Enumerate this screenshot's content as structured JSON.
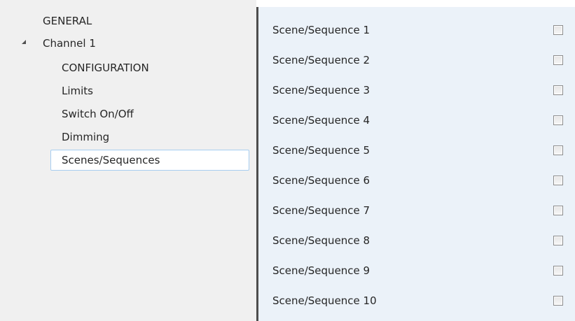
{
  "tree": {
    "general": "GENERAL",
    "channel": "Channel 1",
    "configuration": "CONFIGURATION",
    "limits": "Limits",
    "switch": "Switch On/Off",
    "dimming": "Dimming",
    "scenes": "Scenes/Sequences"
  },
  "params": [
    {
      "label": "Scene/Sequence 1",
      "checked": false
    },
    {
      "label": "Scene/Sequence 2",
      "checked": false
    },
    {
      "label": "Scene/Sequence 3",
      "checked": false
    },
    {
      "label": "Scene/Sequence 4",
      "checked": false
    },
    {
      "label": "Scene/Sequence 5",
      "checked": false
    },
    {
      "label": "Scene/Sequence 6",
      "checked": false
    },
    {
      "label": "Scene/Sequence 7",
      "checked": false
    },
    {
      "label": "Scene/Sequence 8",
      "checked": false
    },
    {
      "label": "Scene/Sequence 9",
      "checked": false
    },
    {
      "label": "Scene/Sequence 10",
      "checked": false
    }
  ]
}
